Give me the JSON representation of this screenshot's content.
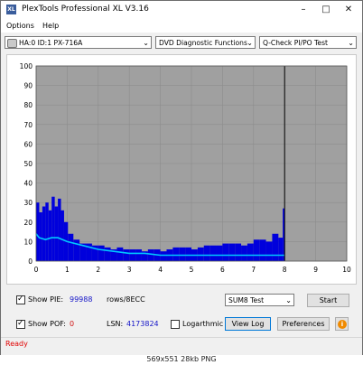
{
  "window": {
    "title": "PlexTools Professional XL V3.16",
    "icon": "plextools-app-icon"
  },
  "menu": {
    "items": [
      "Options",
      "Help"
    ]
  },
  "toolbar": {
    "drive": "HA:0 ID:1  PX-716A",
    "function": "DVD Diagnostic Functions",
    "test": "Q-Check PI/PO Test"
  },
  "chart_data": {
    "type": "area",
    "ylim": [
      0,
      100
    ],
    "xlim": [
      0,
      10
    ],
    "yticks": [
      "100",
      "90",
      "80",
      "70",
      "60",
      "50",
      "40",
      "30",
      "20",
      "10",
      "0"
    ],
    "xticks": [
      "0",
      "1",
      "2",
      "3",
      "4",
      "5",
      "6",
      "7",
      "8",
      "9",
      "10"
    ],
    "grid": true,
    "end_marker_x": 8.0,
    "colors": {
      "bars": "#0000dc",
      "line": "#00c8ff",
      "background": "#a0a0a0",
      "marker": "#000000"
    },
    "series": [
      {
        "name": "",
        "kind": "bars",
        "x": [
          0.05,
          0.15,
          0.25,
          0.35,
          0.45,
          0.55,
          0.65,
          0.75,
          0.85,
          0.95,
          1.1,
          1.3,
          1.5,
          1.7,
          1.9,
          2.1,
          2.3,
          2.5,
          2.7,
          2.9,
          3.1,
          3.3,
          3.5,
          3.7,
          3.9,
          4.1,
          4.3,
          4.5,
          4.7,
          4.9,
          5.1,
          5.3,
          5.5,
          5.7,
          5.9,
          6.1,
          6.3,
          6.5,
          6.7,
          6.9,
          7.1,
          7.3,
          7.5,
          7.7,
          7.9,
          7.98
        ],
        "values": [
          30,
          25,
          28,
          30,
          26,
          33,
          28,
          32,
          26,
          20,
          14,
          11,
          9,
          9,
          8,
          8,
          7,
          6,
          7,
          6,
          6,
          6,
          5,
          6,
          6,
          5,
          6,
          7,
          7,
          7,
          6,
          7,
          8,
          8,
          8,
          9,
          9,
          9,
          8,
          9,
          11,
          11,
          10,
          14,
          12,
          27
        ]
      },
      {
        "name": "",
        "kind": "line",
        "x": [
          0.0,
          0.1,
          0.3,
          0.5,
          0.7,
          1.0,
          1.5,
          2.0,
          2.5,
          3.0,
          3.5,
          4.0,
          4.5,
          5.0,
          5.5,
          6.0,
          6.5,
          7.0,
          7.5,
          8.0
        ],
        "values": [
          14,
          12,
          11,
          12,
          12,
          10,
          8,
          6,
          5,
          4,
          4,
          3,
          3,
          3,
          3,
          3,
          3,
          3,
          3,
          3
        ]
      }
    ]
  },
  "bottom": {
    "show_pie_label": "Show PIE:",
    "pie_value": "99988",
    "rows_label": "rows/8ECC",
    "show_pof_label": "Show POF:",
    "pof_value": "0",
    "lsn_label": "LSN:",
    "lsn_value": "4173824",
    "logarithmic_label": "Logarthmic",
    "test_select": "SUM8 Test",
    "start_button": "Start",
    "view_log_button": "View Log",
    "preferences_button": "Preferences"
  },
  "status": {
    "text": "Ready"
  },
  "caption": "569x551  28kb  PNG"
}
